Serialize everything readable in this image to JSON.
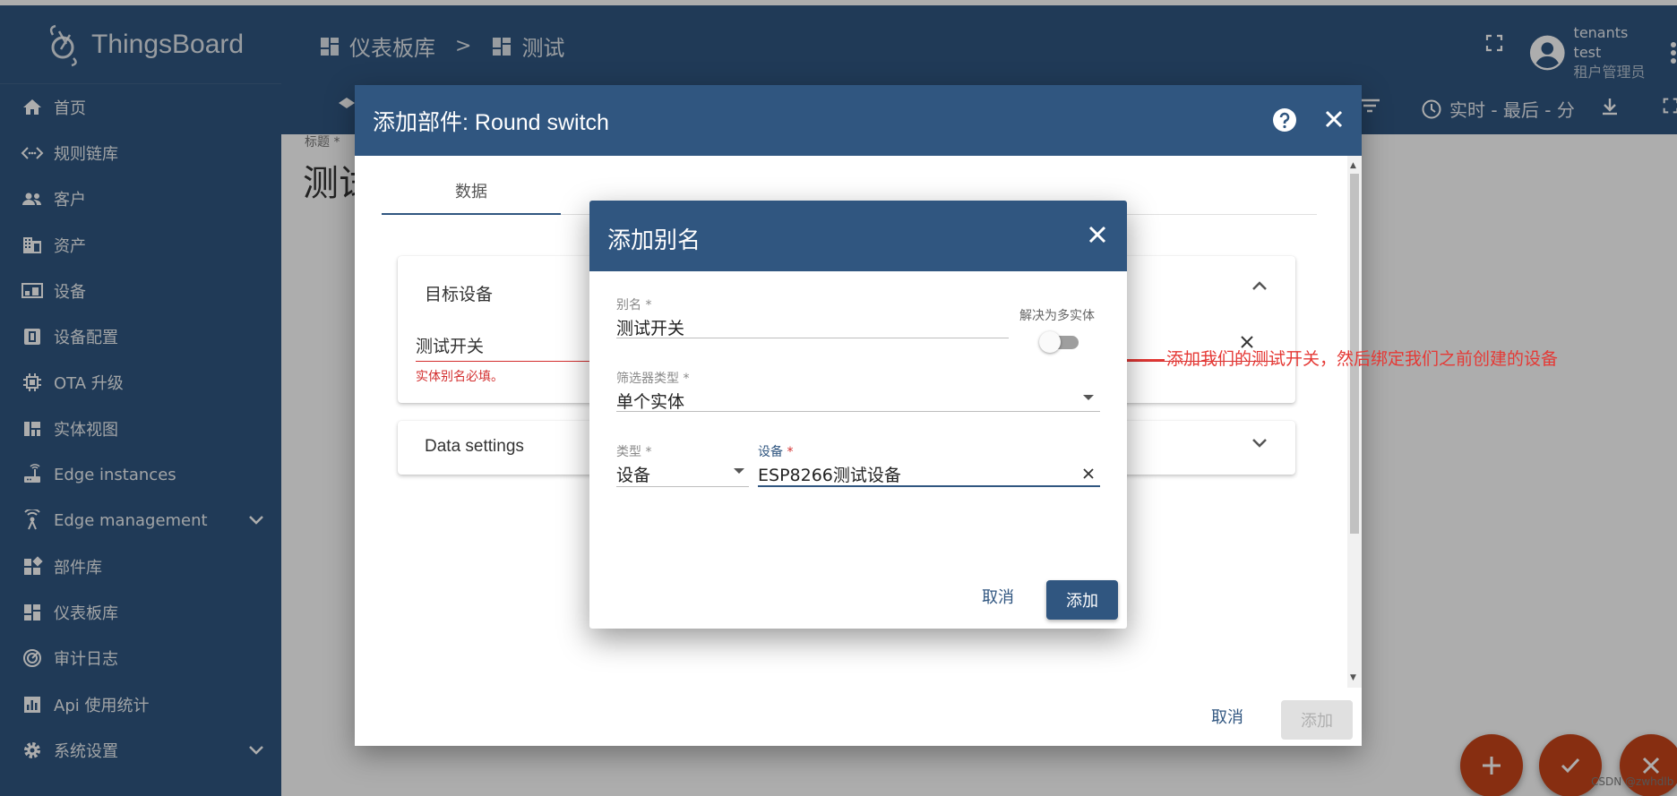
{
  "brand": {
    "name": "ThingsBoard"
  },
  "topbar": {
    "breadcrumb": [
      {
        "label": "仪表板库"
      },
      {
        "label": "测试"
      }
    ],
    "separator": ">",
    "user": {
      "name": "tenants test",
      "role": "租户管理员"
    }
  },
  "sidebar": {
    "items": [
      {
        "label": "首页",
        "icon": "home-icon"
      },
      {
        "label": "规则链库",
        "icon": "code-arrows-icon"
      },
      {
        "label": "客户",
        "icon": "people-icon"
      },
      {
        "label": "资产",
        "icon": "building-icon"
      },
      {
        "label": "设备",
        "icon": "devices-icon"
      },
      {
        "label": "设备配置",
        "icon": "device-profile-icon"
      },
      {
        "label": "OTA 升级",
        "icon": "chip-icon"
      },
      {
        "label": "实体视图",
        "icon": "view-quilt-icon"
      },
      {
        "label": "Edge instances",
        "icon": "router-icon"
      },
      {
        "label": "Edge management",
        "icon": "signal-icon",
        "expandable": true
      },
      {
        "label": "部件库",
        "icon": "widgets-icon"
      },
      {
        "label": "仪表板库",
        "icon": "dashboard-icon"
      },
      {
        "label": "审计日志",
        "icon": "track-changes-icon"
      },
      {
        "label": "Api 使用统计",
        "icon": "bar-chart-icon"
      },
      {
        "label": "系统设置",
        "icon": "settings-icon",
        "expandable": true
      }
    ]
  },
  "dashboard": {
    "page_title_label": "标题 *",
    "page_title": "测试",
    "realtime_label": "实时 - 最后 - 分"
  },
  "widget_dialog": {
    "title": "添加部件: Round switch",
    "tab_data": "数据",
    "target_device_title": "目标设备",
    "alias_value": "测试开关",
    "alias_error": "实体别名必填。",
    "data_settings_title": "Data settings",
    "cancel_label": "取消",
    "add_label": "添加"
  },
  "alias_dialog": {
    "title": "添加别名",
    "alias_label": "别名 *",
    "alias_value": "测试开关",
    "resolve_multiple_label": "解决为多实体",
    "resolve_multiple_on": false,
    "filter_type_label": "筛选器类型 *",
    "filter_type_value": "单个实体",
    "type_label": "类型 *",
    "type_value": "设备",
    "device_label": "设备",
    "device_required": "*",
    "device_value": "ESP8266测试设备",
    "cancel_label": "取消",
    "add_label": "添加"
  },
  "annotation": {
    "text": "添加我们的测试开关，然后绑定我们之前创建的设备"
  },
  "watermark": "CSDN @zwhdlb",
  "colors": {
    "primary": "#305680",
    "fab": "#c8441a",
    "error": "#d32f2f",
    "annotation": "#e53935"
  }
}
